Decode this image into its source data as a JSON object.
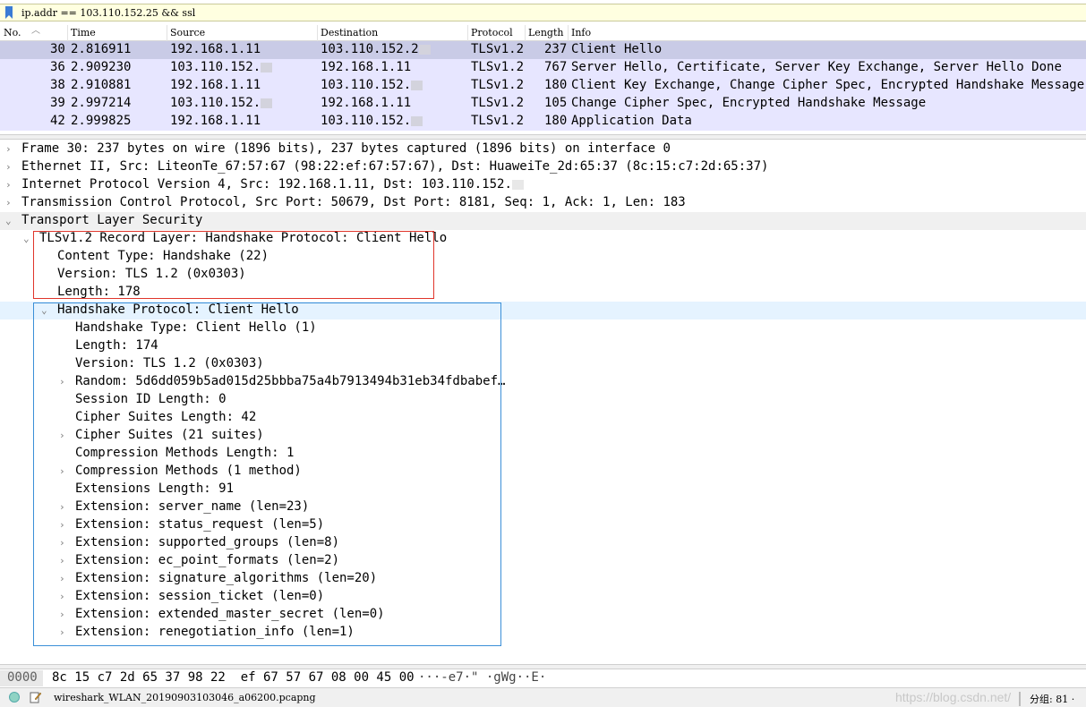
{
  "filter": {
    "text": "ip.addr == 103.110.152.25 && ssl"
  },
  "columns": [
    "No.",
    "Time",
    "Source",
    "Destination",
    "Protocol",
    "Length",
    "Info"
  ],
  "packets": [
    {
      "no": "30",
      "time": "2.816911",
      "source": "192.168.1.11",
      "destination": "103.110.152.2",
      "protocol": "TLSv1.2",
      "length": "237",
      "info": "Client Hello"
    },
    {
      "no": "36",
      "time": "2.909230",
      "source": "103.110.152.",
      "destination": "192.168.1.11",
      "protocol": "TLSv1.2",
      "length": "767",
      "info": "Server Hello, Certificate, Server Key Exchange, Server Hello Done"
    },
    {
      "no": "38",
      "time": "2.910881",
      "source": "192.168.1.11",
      "destination": "103.110.152.",
      "protocol": "TLSv1.2",
      "length": "180",
      "info": "Client Key Exchange, Change Cipher Spec, Encrypted Handshake Message"
    },
    {
      "no": "39",
      "time": "2.997214",
      "source": "103.110.152.",
      "destination": "192.168.1.11",
      "protocol": "TLSv1.2",
      "length": "105",
      "info": "Change Cipher Spec, Encrypted Handshake Message"
    },
    {
      "no": "42",
      "time": "2.999825",
      "source": "192.168.1.11",
      "destination": "103.110.152.",
      "protocol": "TLSv1.2",
      "length": "180",
      "info": "Application Data"
    }
  ],
  "details": [
    {
      "text": "Frame 30: 237 bytes on wire (1896 bits), 237 bytes captured (1896 bits) on interface 0",
      "arrow": "right"
    },
    {
      "text": "Ethernet II, Src: LiteonTe_67:57:67 (98:22:ef:67:57:67), Dst: HuaweiTe_2d:65:37 (8c:15:c7:2d:65:37)",
      "arrow": "right"
    },
    {
      "text": "Internet Protocol Version 4, Src: 192.168.1.11, Dst: 103.110.152.",
      "arrow": "right"
    },
    {
      "text": "Transmission Control Protocol, Src Port: 50679, Dst Port: 8181, Seq: 1, Ack: 1, Len: 183",
      "arrow": "right"
    },
    {
      "text": "Transport Layer Security",
      "arrow": "down"
    },
    {
      "text": "TLSv1.2 Record Layer: Handshake Protocol: Client Hello",
      "arrow": "down"
    },
    {
      "text": "Content Type: Handshake (22)",
      "arrow": ""
    },
    {
      "text": "Version: TLS 1.2 (0x0303)",
      "arrow": ""
    },
    {
      "text": "Length: 178",
      "arrow": ""
    },
    {
      "text": "Handshake Protocol: Client Hello",
      "arrow": "down"
    },
    {
      "text": "Handshake Type: Client Hello (1)",
      "arrow": ""
    },
    {
      "text": "Length: 174",
      "arrow": ""
    },
    {
      "text": "Version: TLS 1.2 (0x0303)",
      "arrow": ""
    },
    {
      "text": "Random: 5d6dd059b5ad015d25bbba75a4b7913494b31eb34fdbabef…",
      "arrow": "right"
    },
    {
      "text": "Session ID Length: 0",
      "arrow": ""
    },
    {
      "text": "Cipher Suites Length: 42",
      "arrow": ""
    },
    {
      "text": "Cipher Suites (21 suites)",
      "arrow": "right"
    },
    {
      "text": "Compression Methods Length: 1",
      "arrow": ""
    },
    {
      "text": "Compression Methods (1 method)",
      "arrow": "right"
    },
    {
      "text": "Extensions Length: 91",
      "arrow": ""
    },
    {
      "text": "Extension: server_name (len=23)",
      "arrow": "right"
    },
    {
      "text": "Extension: status_request (len=5)",
      "arrow": "right"
    },
    {
      "text": "Extension: supported_groups (len=8)",
      "arrow": "right"
    },
    {
      "text": "Extension: ec_point_formats (len=2)",
      "arrow": "right"
    },
    {
      "text": "Extension: signature_algorithms (len=20)",
      "arrow": "right"
    },
    {
      "text": "Extension: session_ticket (len=0)",
      "arrow": "right"
    },
    {
      "text": "Extension: extended_master_secret (len=0)",
      "arrow": "right"
    },
    {
      "text": "Extension: renegotiation_info (len=1)",
      "arrow": "right"
    }
  ],
  "bytes": {
    "offset": "0000",
    "hex": "8c 15 c7 2d 65 37 98 22  ef 67 57 67 08 00 45 00",
    "ascii": "···-e7·\" ·gWg··E·"
  },
  "status": {
    "file": "wireshark_WLAN_20190903103046_a06200.pcapng",
    "watermark": "https://blog.csdn.net/",
    "packets": "分组: 81 ·"
  }
}
